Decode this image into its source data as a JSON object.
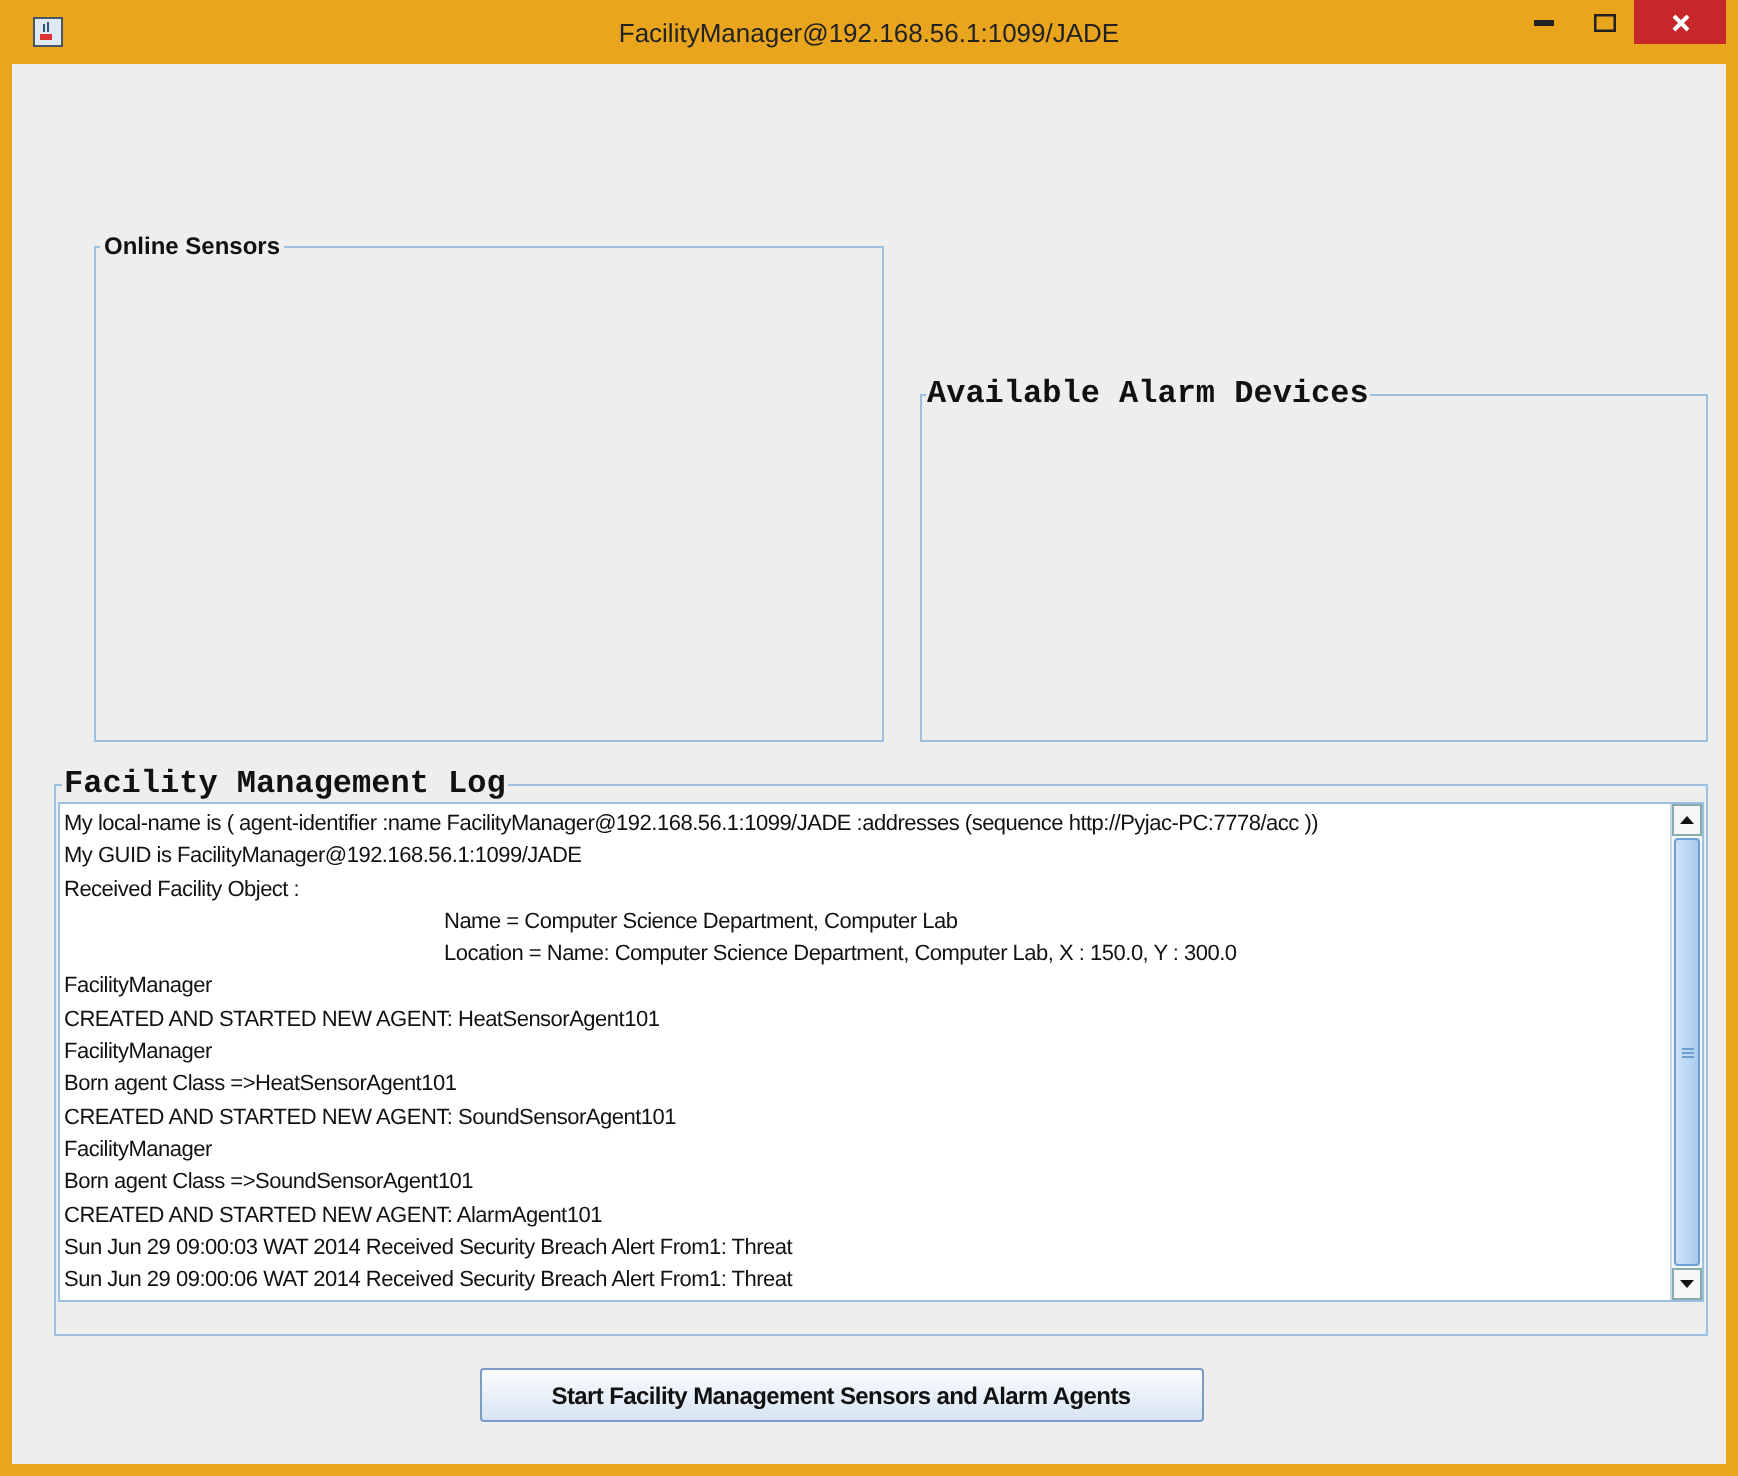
{
  "window": {
    "title": "FacilityManager@192.168.56.1:1099/JADE"
  },
  "online_sensors": {
    "title": "Online Sensors"
  },
  "alarm_devices": {
    "title": "Available Alarm Devices"
  },
  "log": {
    "title": "Facility Management Log",
    "lines": [
      {
        "kind": "plain",
        "text": "My local-name is ( agent-identifier :name FacilityManager@192.168.56.1:1099/JADE  :addresses (sequence http://Pyjac-PC:7778/acc ))"
      },
      {
        "kind": "plain",
        "text": "My GUID is FacilityManager@192.168.56.1:1099/JADE"
      },
      {
        "kind": "plain",
        "text": "Received Facility Object :"
      },
      {
        "kind": "indented",
        "text": "Name = Computer Science Department, Computer Lab"
      },
      {
        "kind": "indented",
        "text": "Location = Name: Computer Science Department, Computer Lab, X : 150.0, Y : 300.0"
      },
      {
        "kind": "plain",
        "text": "FacilityManager"
      },
      {
        "kind": "plain",
        "text": "CREATED AND STARTED NEW AGENT: HeatSensorAgent101"
      },
      {
        "kind": "plain",
        "text": "FacilityManager"
      },
      {
        "kind": "plain",
        "text": "Born agent Class =>HeatSensorAgent101"
      },
      {
        "kind": "plain",
        "text": "CREATED AND STARTED NEW AGENT: SoundSensorAgent101"
      },
      {
        "kind": "plain",
        "text": "FacilityManager"
      },
      {
        "kind": "plain",
        "text": "Born agent Class =>SoundSensorAgent101"
      },
      {
        "kind": "plain",
        "text": "CREATED AND STARTED NEW AGENT: AlarmAgent101"
      },
      {
        "kind": "plain",
        "text": "Sun Jun 29 09:00:03 WAT 2014 Received Security Breach Alert From1: Threat"
      },
      {
        "kind": "plain",
        "text": "Sun Jun 29 09:00:06 WAT 2014 Received Security Breach Alert From1: Threat"
      }
    ]
  },
  "start_button": {
    "label": "Start Facility Management Sensors and Alarm Agents"
  }
}
